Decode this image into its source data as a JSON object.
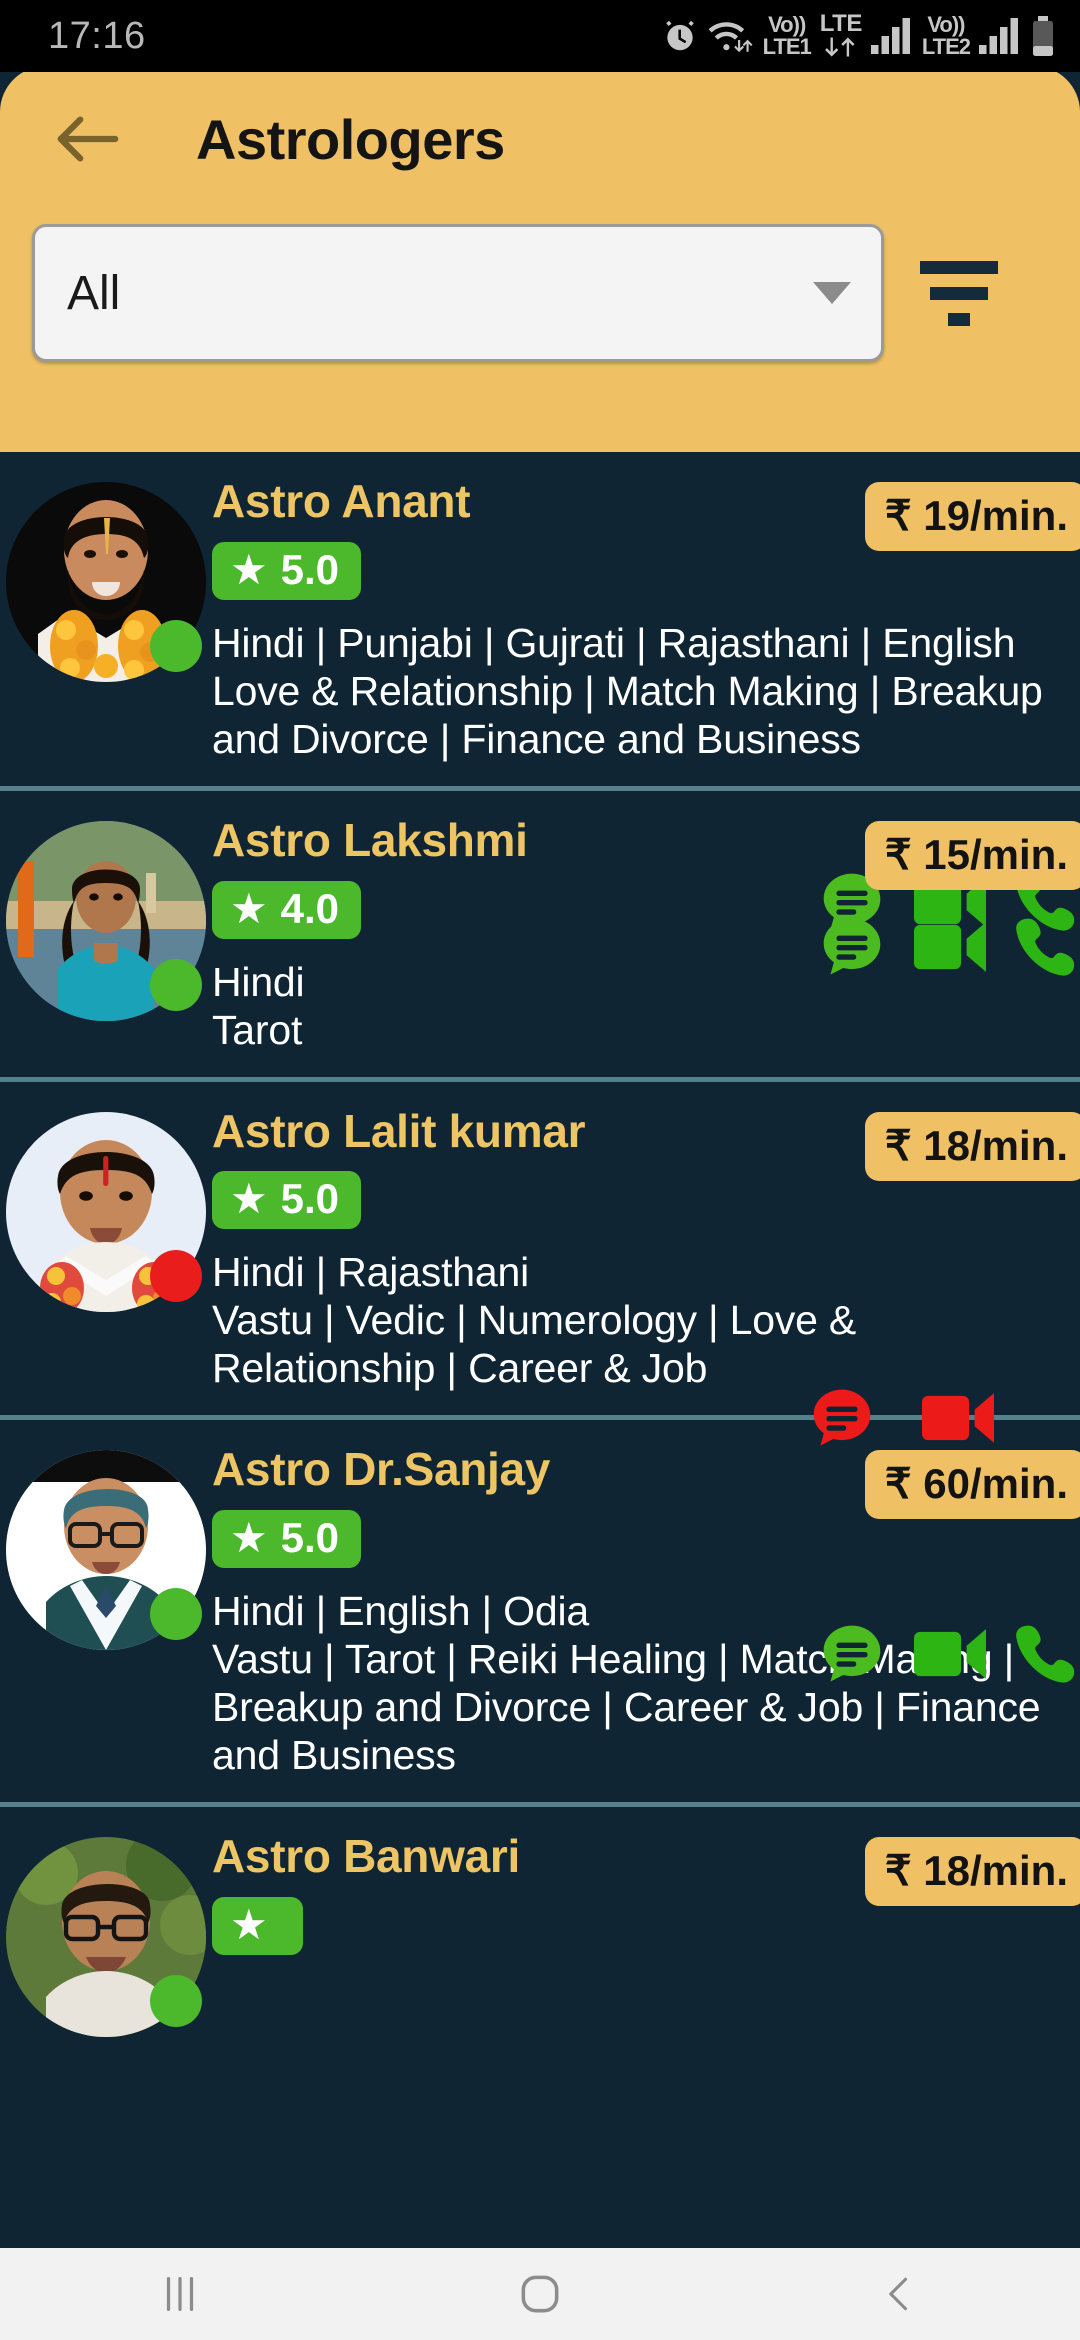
{
  "status_bar": {
    "time": "17:16",
    "icons": [
      "alarm-icon",
      "wifi-icon",
      "volte-sim1-icon",
      "lte-data-icon",
      "signal-sim1-icon",
      "volte-sim2-icon",
      "signal-sim2-icon",
      "battery-icon"
    ],
    "volte1_label": "Vo))",
    "volte1_sub": "LTE1",
    "lte_label": "LTE",
    "volte2_label": "Vo))",
    "volte2_sub": "LTE2"
  },
  "header": {
    "title": "Astrologers",
    "back_icon": "back-arrow-icon",
    "filter_icon": "filter-icon",
    "dropdown": {
      "value": "All",
      "placeholder": "All",
      "caret_icon": "chevron-down-icon"
    }
  },
  "colors": {
    "header_bg": "#efc164",
    "page_bg": "#0f2533",
    "accent_gold": "#eec565",
    "rating_green": "#4cb82c",
    "online_green": "#4cb82c",
    "offline_red": "#ea1d1d",
    "divider": "#55818c",
    "price_badge": "#efc164",
    "nav_bg": "#f2f2f2"
  },
  "astrologers": [
    {
      "name": "Astro  Anant",
      "rating": "5.0",
      "price": "₹ 19/min.",
      "languages": "Hindi | Punjabi | Gujrati | Rajasthani | English",
      "skills": "Love & Relationship | Match Making | Breakup and Divorce | Finance and Business",
      "status": "online",
      "actions": [
        "chat-icon",
        "video-call-icon",
        "phone-call-icon"
      ],
      "action_state": "available"
    },
    {
      "name": "Astro Lakshmi",
      "rating": "4.0",
      "price": "₹ 15/min.",
      "languages": "Hindi",
      "skills": "Tarot",
      "status": "online",
      "actions": [
        "chat-icon",
        "video-call-icon",
        "phone-call-icon"
      ],
      "action_state": "available"
    },
    {
      "name": "Astro Lalit kumar",
      "rating": "5.0",
      "price": "₹ 18/min.",
      "languages": "Hindi | Rajasthani",
      "skills": "Vastu | Vedic | Numerology | Love & Relationship | Career & Job",
      "status": "offline",
      "actions": [
        "chat-icon",
        "video-call-icon"
      ],
      "action_state": "busy"
    },
    {
      "name": "Astro Dr.Sanjay",
      "rating": "5.0",
      "price": "₹ 60/min.",
      "languages": "Hindi | English | Odia",
      "skills": "Vastu | Tarot | Reiki Healing | Match Making | Breakup and Divorce | Career & Job | Finance and Business",
      "status": "online",
      "actions": [
        "chat-icon",
        "video-call-icon",
        "phone-call-icon"
      ],
      "action_state": "available"
    },
    {
      "name": "Astro Banwari",
      "rating": "",
      "price": "₹ 18/min.",
      "languages": "",
      "skills": "",
      "status": "online",
      "actions": [],
      "action_state": "available"
    }
  ],
  "nav_bar": {
    "recents_icon": "recent-apps-icon",
    "home_icon": "home-icon",
    "back_icon": "back-nav-icon"
  }
}
